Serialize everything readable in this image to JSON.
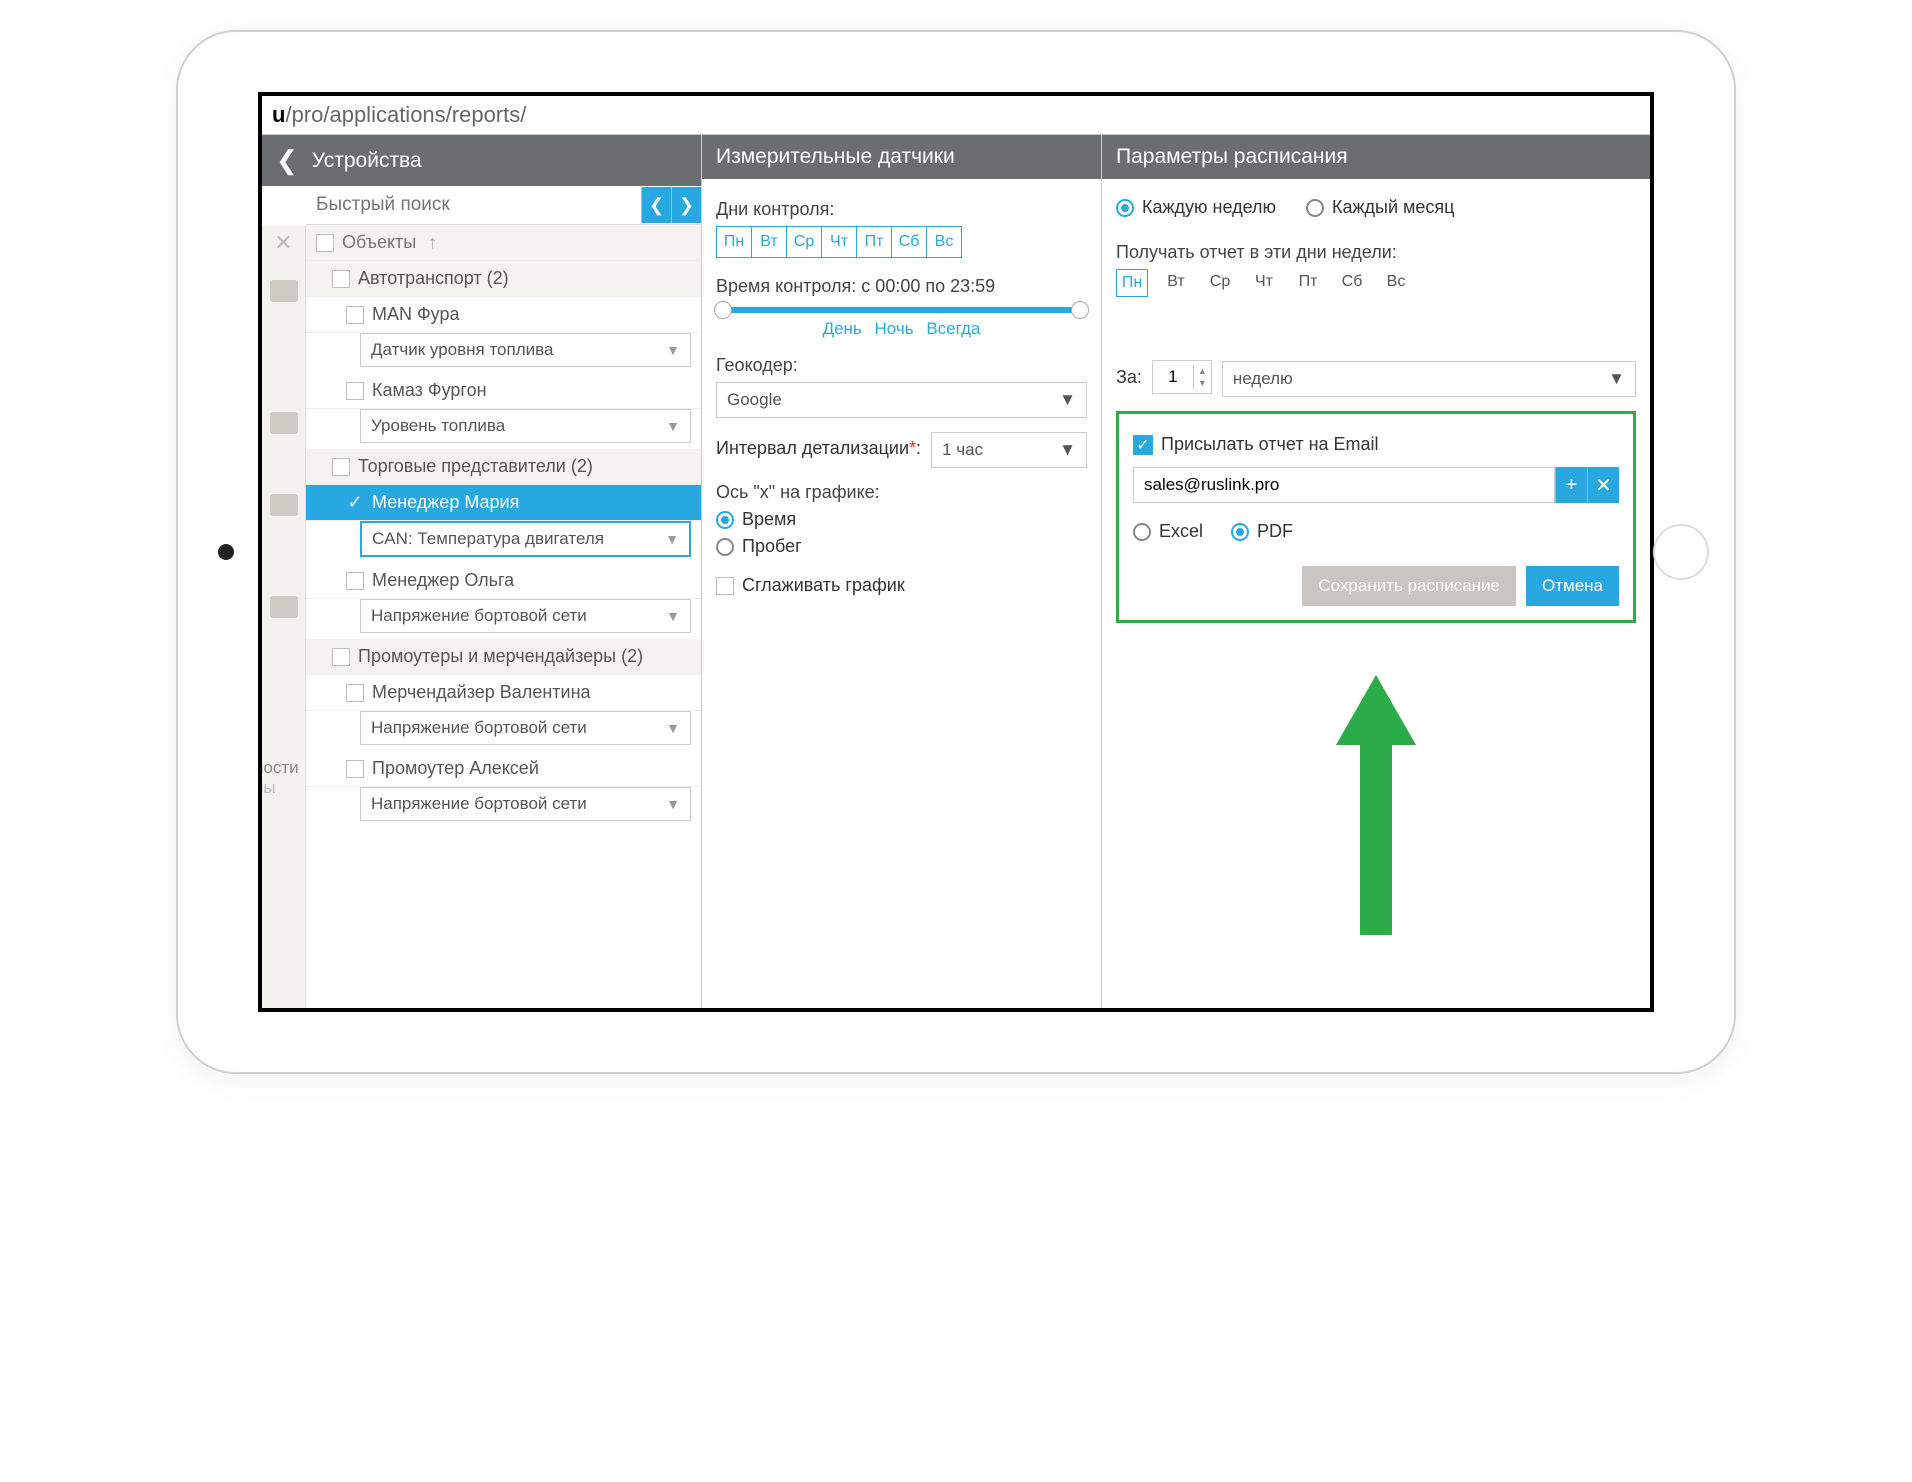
{
  "url_prefix": "u",
  "url_path": "/pro/applications/reports/",
  "devices": {
    "header": "Устройства",
    "search_placeholder": "Быстрый поиск",
    "objects_header": "Объекты",
    "groups": [
      {
        "name": "Автотранспорт (2)",
        "items": [
          {
            "name": "MAN Фура",
            "sensor": "Датчик уровня топлива"
          },
          {
            "name": "Камаз Фургон",
            "sensor": "Уровень топлива"
          }
        ]
      },
      {
        "name": "Торговые представители (2)",
        "items": [
          {
            "name": "Менеджер Мария",
            "sensor": "CAN: Температура двигателя",
            "selected": true
          },
          {
            "name": "Менеджер Ольга",
            "sensor": "Напряжение бортовой сети"
          }
        ]
      },
      {
        "name": "Промоутеры и мерчендайзеры (2)",
        "items": [
          {
            "name": "Мерчендайзер Валентина",
            "sensor": "Напряжение бортовой сети"
          },
          {
            "name": "Промоутер Алексей",
            "sensor": "Напряжение бортовой сети"
          }
        ]
      }
    ],
    "side_fragment_1": "ности",
    "side_fragment_2": "ны"
  },
  "sensors": {
    "header": "Измерительные датчики",
    "days_label": "Дни контроля:",
    "days": [
      "Пн",
      "Вт",
      "Ср",
      "Чт",
      "Пт",
      "Сб",
      "Вс"
    ],
    "time_label": "Время контроля: с 00:00 по 23:59",
    "preset_day": "День",
    "preset_night": "Ночь",
    "preset_always": "Всегда",
    "geocoder_label": "Геокодер:",
    "geocoder_value": "Google",
    "interval_label": "Интервал детализации",
    "interval_value": "1 час",
    "xaxis_label": "Ось \"х\" на графике:",
    "xaxis_time": "Время",
    "xaxis_mileage": "Пробег",
    "smooth_label": "Сглаживать график"
  },
  "schedule": {
    "header": "Параметры расписания",
    "weekly": "Каждую неделю",
    "monthly": "Каждый месяц",
    "receive_label": "Получать отчет в эти дни недели:",
    "days": [
      "Пн",
      "Вт",
      "Ср",
      "Чт",
      "Пт",
      "Сб",
      "Вс"
    ],
    "for_label": "За:",
    "for_value": "1",
    "for_unit": "неделю",
    "email_cb_label": "Присылать отчет на Email",
    "email_value": "sales@ruslink.pro",
    "fmt_excel": "Excel",
    "fmt_pdf": "PDF",
    "save_btn": "Сохранить расписание",
    "cancel_btn": "Отмена"
  }
}
